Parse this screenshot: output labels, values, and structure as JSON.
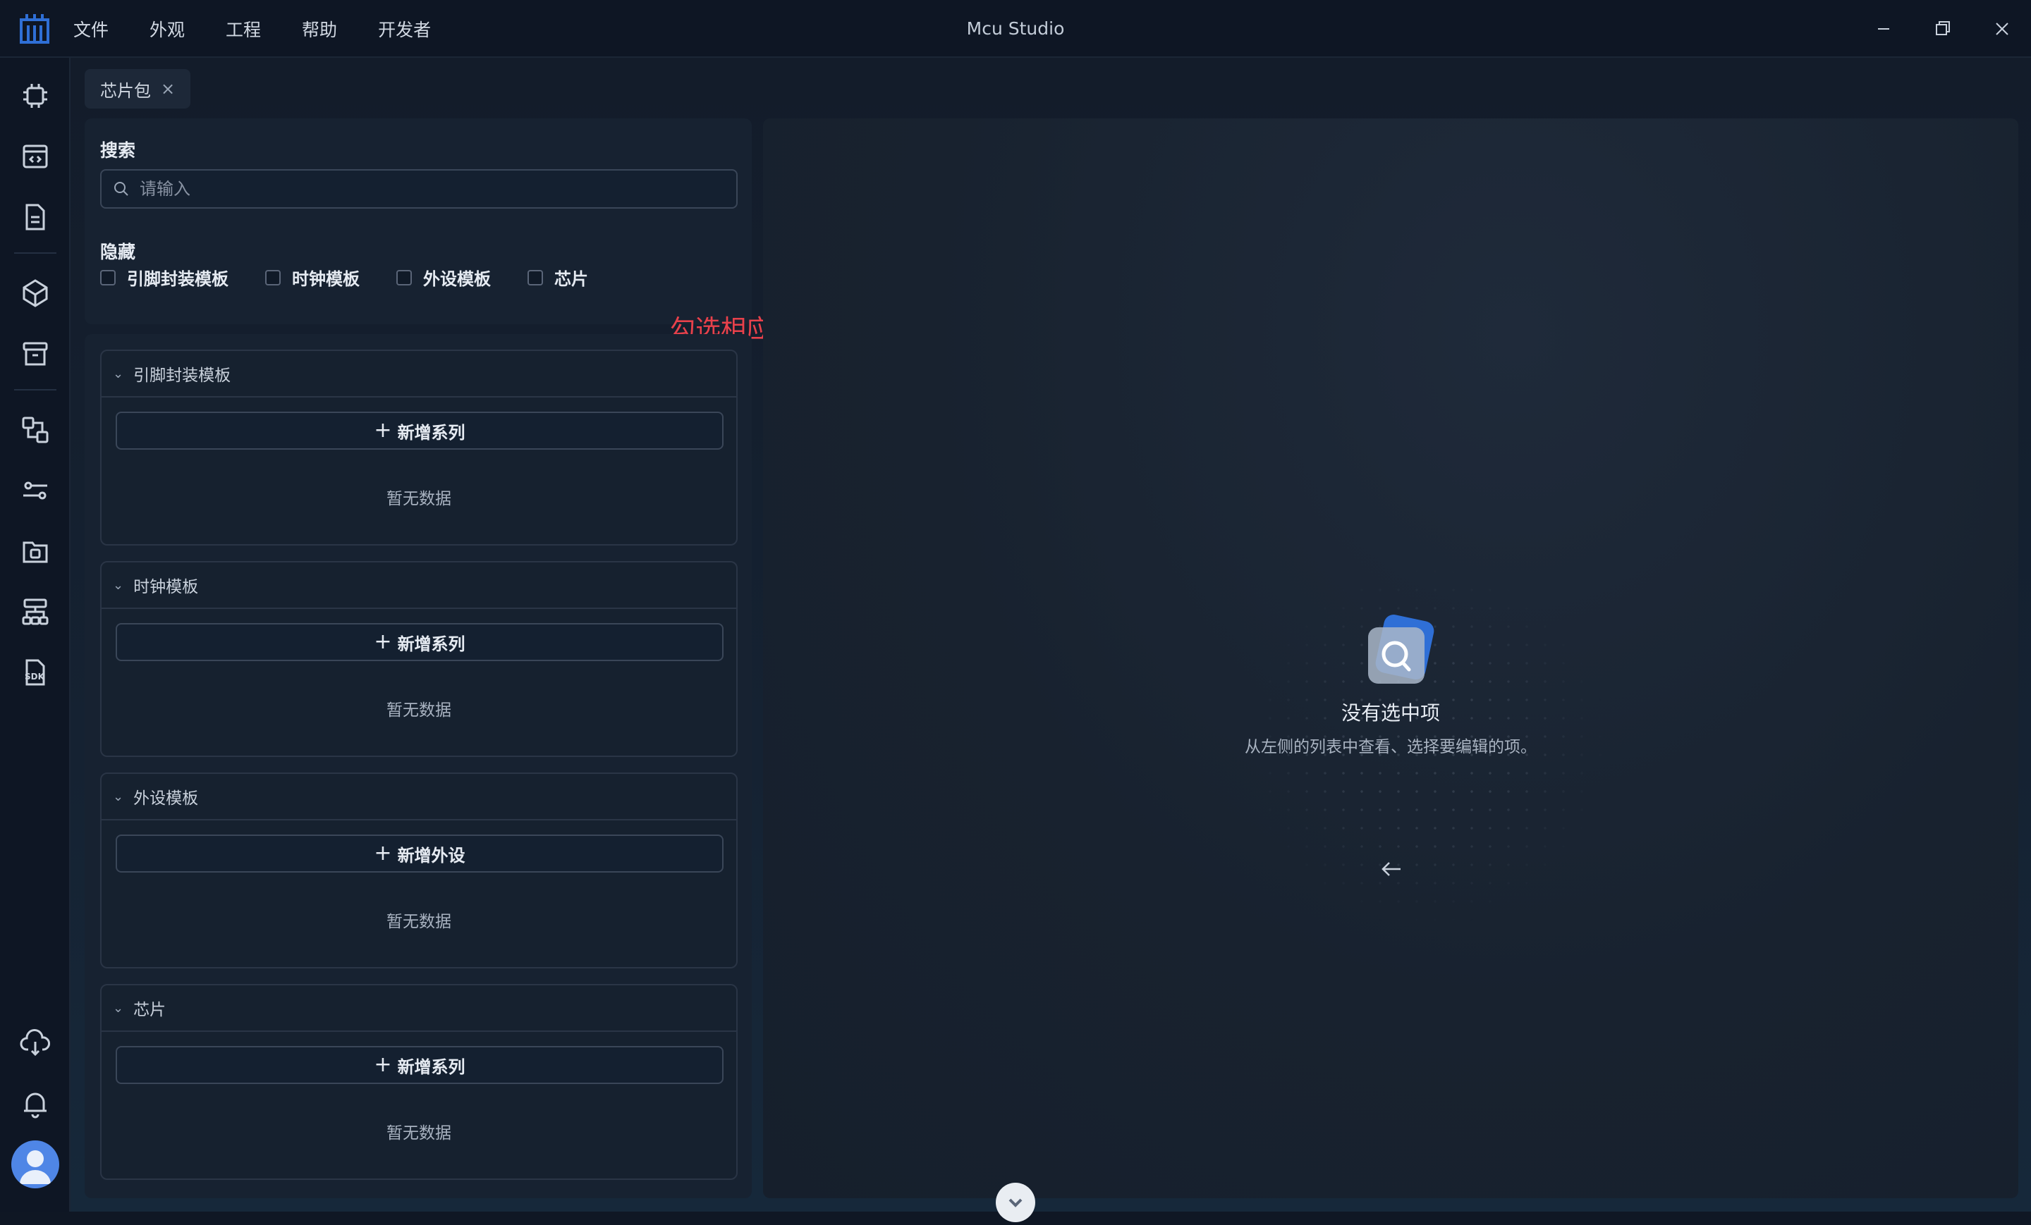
{
  "app": {
    "title": "Mcu Studio",
    "accent_color": "#2f6fd6",
    "annotation_color": "#e8414b"
  },
  "menu": {
    "items": [
      "文件",
      "外观",
      "工程",
      "帮助",
      "开发者"
    ]
  },
  "sidebar": {
    "icons": [
      "chip-icon",
      "code-window-icon",
      "document-icon",
      "cube-icon",
      "archive-icon",
      "diagram-icon",
      "sliders-icon",
      "camera-folder-icon",
      "hierarchy-icon",
      "sdk-icon",
      "cloud-download-icon",
      "bell-icon"
    ]
  },
  "tab": {
    "label": "芯片包",
    "close": "×"
  },
  "filter": {
    "search_label": "搜索",
    "search_placeholder": "请输入",
    "hide_label": "隐藏",
    "checkboxes": [
      {
        "label": "引脚封装模板",
        "checked": false
      },
      {
        "label": "时钟模板",
        "checked": false
      },
      {
        "label": "外设模板",
        "checked": false
      },
      {
        "label": "芯片",
        "checked": false
      }
    ]
  },
  "annotation": {
    "text": "勾选相应的模板可以暂时隐藏相关配置项"
  },
  "groups": [
    {
      "title": "引脚封装模板",
      "add_label": "新增系列",
      "empty": "暂无数据"
    },
    {
      "title": "时钟模板",
      "add_label": "新增系列",
      "empty": "暂无数据"
    },
    {
      "title": "外设模板",
      "add_label": "新增外设",
      "empty": "暂无数据"
    },
    {
      "title": "芯片",
      "add_label": "新增系列",
      "empty": "暂无数据"
    }
  ],
  "detail": {
    "empty_title": "没有选中项",
    "empty_subtitle": "从左侧的列表中查看、选择要编辑的项。"
  }
}
